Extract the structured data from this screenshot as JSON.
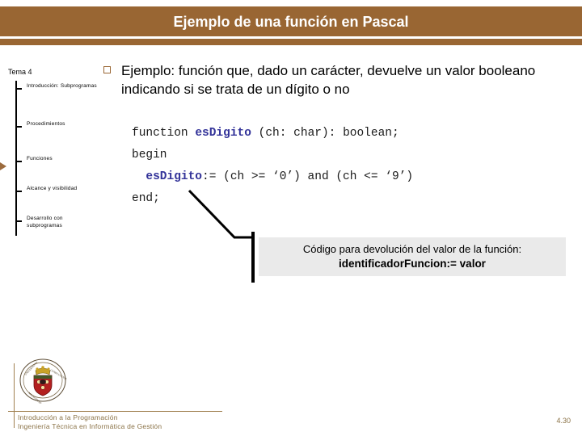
{
  "slide": {
    "title": "Ejemplo de una función en Pascal",
    "accent_color": "#996633",
    "page_number": "4.30"
  },
  "sidebar": {
    "title": "Tema 4",
    "marker_icon": "triangle-right-marker",
    "active_index": 2,
    "items": [
      {
        "label": "Introducción: Subprogramas"
      },
      {
        "label": "Procedimientos"
      },
      {
        "label": "Funciones"
      },
      {
        "label": "Alcance y visibilidad"
      },
      {
        "label": "Desarrollo con subprogramas"
      }
    ]
  },
  "main": {
    "bullet_icon": "square-bullet",
    "bullet_text": "Ejemplo: función que, dado un carácter, devuelve un valor booleano indicando si se trata de un dígito o no",
    "code": {
      "line1_pre": "function ",
      "line1_name": "esDigito",
      "line1_post": " (ch: char): boolean;",
      "line2": "begin",
      "line3_name": "esDigito",
      "line3_post": ":= (ch >= ‘0’) and (ch <= ‘9’)",
      "line4": "end;",
      "highlight_color": "#333399"
    },
    "callout": {
      "line1": "Código para devolución del valor de la función:",
      "line2": "identificadorFuncion:= valor",
      "background": "#eaeaea"
    }
  },
  "footer": {
    "seal_icon": "university-seal",
    "line1": "Introducción a la Programación",
    "line2": "Ingeniería Técnica en Informática de Gestión",
    "text_color": "#8a7246"
  }
}
